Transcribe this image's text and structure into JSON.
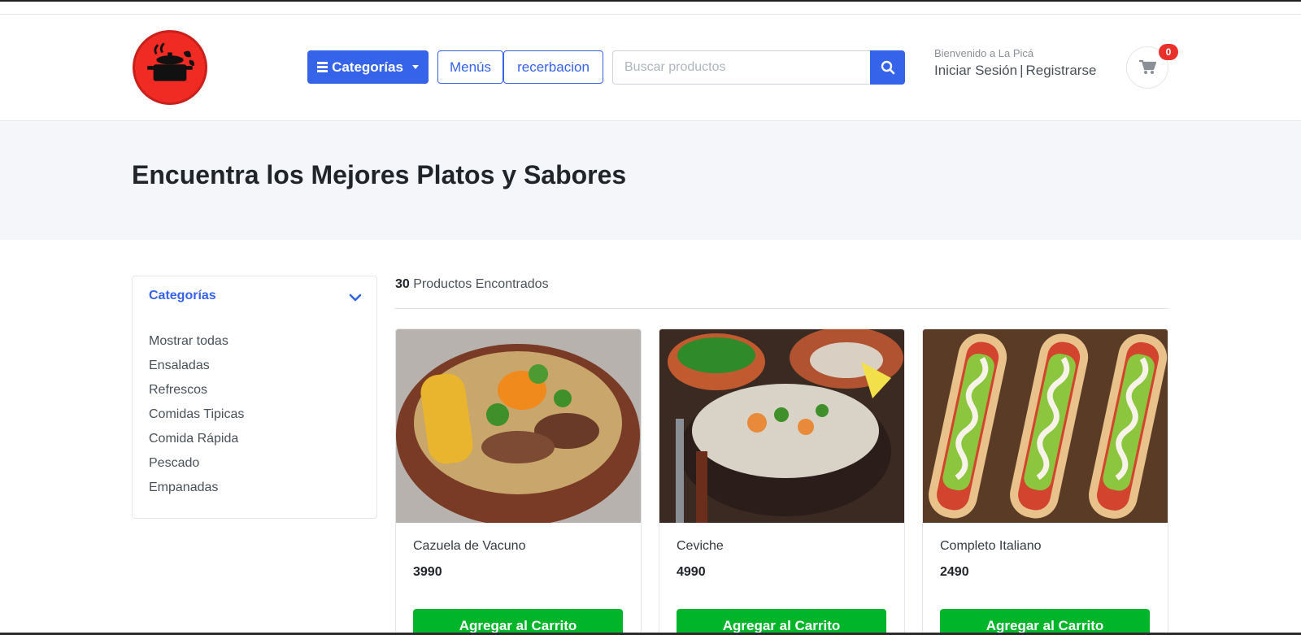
{
  "header": {
    "logo_icon": "cooking-pot-logo",
    "categories_label": "Categorías",
    "menus_label": "Menús",
    "reservation_label": "recerbacion",
    "search": {
      "placeholder": "Buscar productos",
      "value": ""
    },
    "welcome": "Bienvenido a La Picá",
    "login_label": "Iniciar Sesión",
    "separator": "|",
    "register_label": "Registrarse",
    "cart_count": "0"
  },
  "hero": {
    "title": "Encuentra los Mejores Platos y Sabores"
  },
  "sidebar": {
    "title": "Categorías",
    "items": [
      "Mostrar todas",
      "Ensaladas",
      "Refrescos",
      "Comidas Tipicas",
      "Comida Rápida",
      "Pescado",
      "Empanadas"
    ]
  },
  "results": {
    "count": "30",
    "label": "Productos Encontrados"
  },
  "products": [
    {
      "name": "Cazuela de Vacuno",
      "price": "3990",
      "button": "Agregar al Carrito"
    },
    {
      "name": "Ceviche",
      "price": "4990",
      "button": "Agregar al Carrito"
    },
    {
      "name": "Completo Italiano",
      "price": "2490",
      "button": "Agregar al Carrito"
    }
  ],
  "colors": {
    "primary": "#3563e9",
    "success": "#00b52a",
    "logo": "#ef2b24",
    "badge": "#e8312b"
  }
}
